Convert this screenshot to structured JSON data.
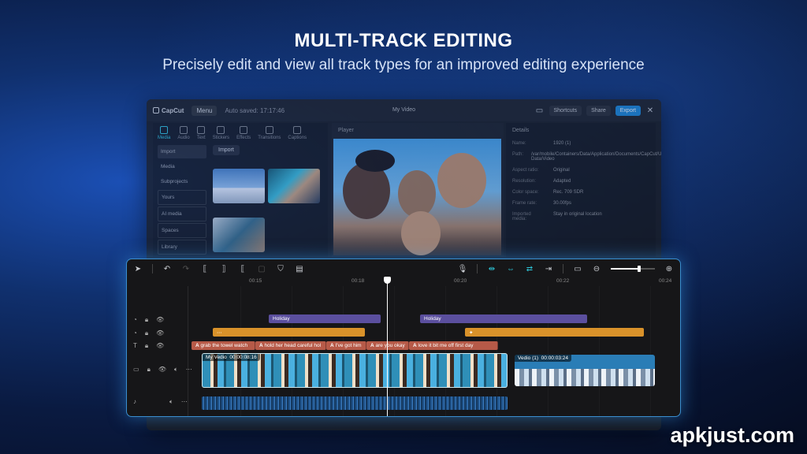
{
  "header": {
    "title": "MULTI-TRACK EDITING",
    "subtitle": "Precisely edit and view all track types for an improved editing experience"
  },
  "watermark": "apkjust.com",
  "background_window": {
    "app_name": "CapCut",
    "menu_label": "Menu",
    "autosave_text": "Auto saved: 17:17:46",
    "project_title": "My Video",
    "shortcuts_label": "Shortcuts",
    "share_label": "Share",
    "export_label": "Export",
    "tools": [
      "Media",
      "Audio",
      "Text",
      "Stickers",
      "Effects",
      "Transitions",
      "Captions"
    ],
    "media_side": [
      "Import",
      "Media",
      "Subprojects",
      "Yours",
      "AI media",
      "Spaces",
      "Library"
    ],
    "import_label": "Import",
    "all_label": "All",
    "player_label": "Player",
    "details_label": "Details",
    "details": [
      {
        "k": "Name:",
        "v": "1920 (1)"
      },
      {
        "k": "Path:",
        "v": "/var/mobile/Containers/Data/Application/Documents/CapCut/User Data/Video"
      },
      {
        "k": "Aspect ratio:",
        "v": "Original"
      },
      {
        "k": "Resolution:",
        "v": "Adapted"
      },
      {
        "k": "Color space:",
        "v": "Rec. 709 SDR"
      },
      {
        "k": "Frame rate:",
        "v": "30.00fps"
      },
      {
        "k": "Imported media:",
        "v": "Stay in original location"
      }
    ]
  },
  "timeline": {
    "ruler": [
      "00:15",
      "00:18",
      "00:20",
      "00:22",
      "00:24"
    ],
    "sticker_clips": [
      "Holiday",
      "Holiday"
    ],
    "caption_clips": [
      "grab the towel watch",
      "hold her head careful hol",
      "I've got him",
      "are you okay",
      "love it bit me off first day"
    ],
    "caption_prefix": "A̲",
    "video_main_name": "My Vedio",
    "video_main_time": "00:00:08:16",
    "video_second_name": "Vedio (1)",
    "video_second_time": "00:00:03:24",
    "colors": {
      "accent": "#2ec4d6",
      "sticker": "#5b4f9e",
      "effect": "#d9922a",
      "caption": "#b65a48",
      "border": "#3a8ecf"
    }
  }
}
